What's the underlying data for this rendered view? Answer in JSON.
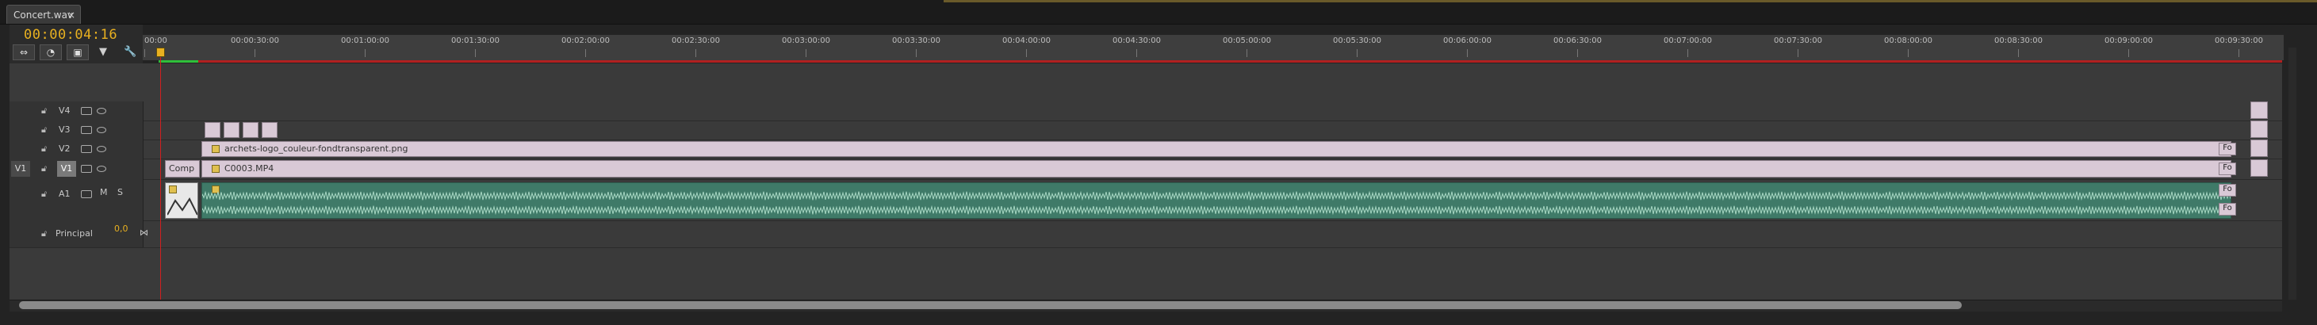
{
  "tab": {
    "title": "Concert.wav",
    "close": "×"
  },
  "timecode": "00:00:04:16",
  "toolbar": [
    {
      "name": "snap-button",
      "glyph": "⇔"
    },
    {
      "name": "linked-selection-button",
      "glyph": "◔"
    },
    {
      "name": "add-marker-button",
      "glyph": "▣"
    }
  ],
  "toolbar_icons": [
    {
      "name": "marker-icon",
      "glyph": "▼"
    },
    {
      "name": "wrench-icon",
      "glyph": "🔧"
    }
  ],
  "ruler": {
    "labels": [
      "00:00",
      "00:00:30:00",
      "00:01:00:00",
      "00:01:30:00",
      "00:02:00:00",
      "00:02:30:00",
      "00:03:00:00",
      "00:03:30:00",
      "00:04:00:00",
      "00:04:30:00",
      "00:05:00:00",
      "00:05:30:00",
      "00:06:00:00",
      "00:06:30:00",
      "00:07:00:00",
      "00:07:30:00",
      "00:08:00:00",
      "00:08:30:00",
      "00:09:00:00",
      "00:09:30:00"
    ]
  },
  "tracks": {
    "v4": {
      "label": "V4"
    },
    "v3": {
      "label": "V3"
    },
    "v2": {
      "label": "V2"
    },
    "v1": {
      "label": "V1",
      "source": "V1"
    },
    "a1": {
      "label": "A1",
      "mute": "M",
      "solo": "S"
    },
    "master": {
      "label": "Principal",
      "value": "0,0"
    }
  },
  "clips": {
    "logo": "archets-logo_couleur-fondtransparent.png",
    "video": "C0003.MP4",
    "comp": "Comp",
    "end_marker": "Fo",
    "audio_fx": "fx"
  }
}
